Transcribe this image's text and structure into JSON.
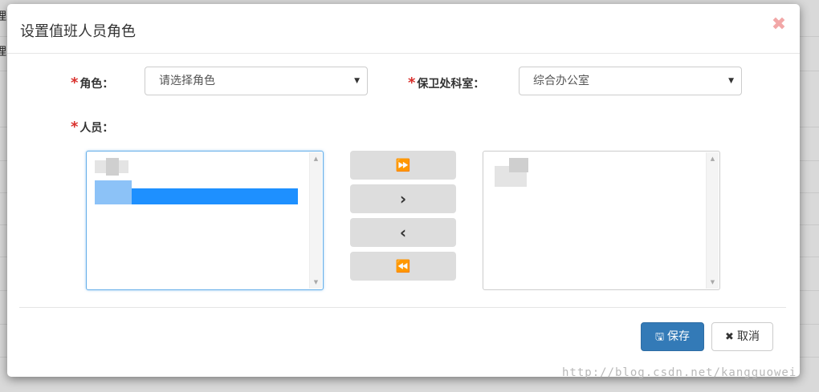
{
  "background": {
    "row_chars": [
      "理",
      "理"
    ]
  },
  "modal": {
    "title": "设置值班人员角色",
    "close_icon": "close-icon"
  },
  "form": {
    "required_mark": "*",
    "role_label": "角色：",
    "role_select_value": "请选择角色",
    "dept_label": "保卫处科室：",
    "dept_select_value": "综合办公室",
    "personnel_label": "人员："
  },
  "transfer": {
    "move_all_right": "⏩",
    "move_right": "›",
    "move_left": "‹",
    "move_all_left": "⏪"
  },
  "footer": {
    "save_label": "保存",
    "cancel_label": "取消",
    "save_icon": "floppy-disk-icon",
    "cancel_icon": "x-icon"
  },
  "watermark": "http://blog.csdn.net/kangguowei",
  "colors": {
    "primary": "#337ab7",
    "required": "#d9302c",
    "selected_option": "#1e90ff"
  }
}
